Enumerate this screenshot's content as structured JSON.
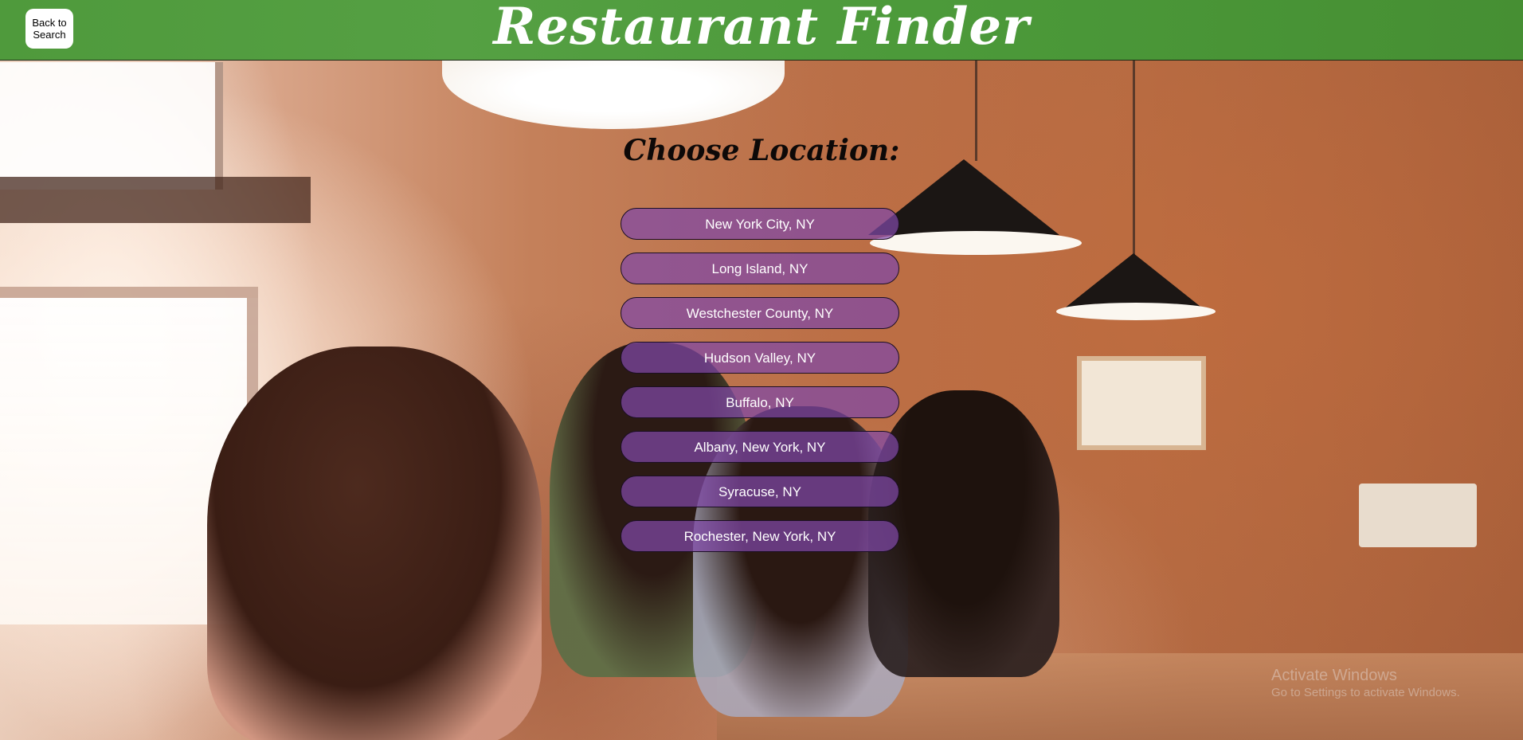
{
  "header": {
    "title": "Restaurant Finder",
    "back_button_label": "Back to\nSearch",
    "background_color": "#55a043"
  },
  "main": {
    "heading": "Choose Location:",
    "locations": [
      {
        "label": "New York City, NY"
      },
      {
        "label": "Long Island, NY"
      },
      {
        "label": "Westchester County, NY"
      },
      {
        "label": "Hudson Valley, NY"
      },
      {
        "label": "Buffalo, NY"
      },
      {
        "label": "Albany, New York, NY"
      },
      {
        "label": "Syracuse, NY"
      },
      {
        "label": "Rochester, New York, NY"
      }
    ],
    "button_color": "#8048a8"
  },
  "watermark": {
    "title": "Activate Windows",
    "subtitle": "Go to Settings to activate Windows."
  }
}
